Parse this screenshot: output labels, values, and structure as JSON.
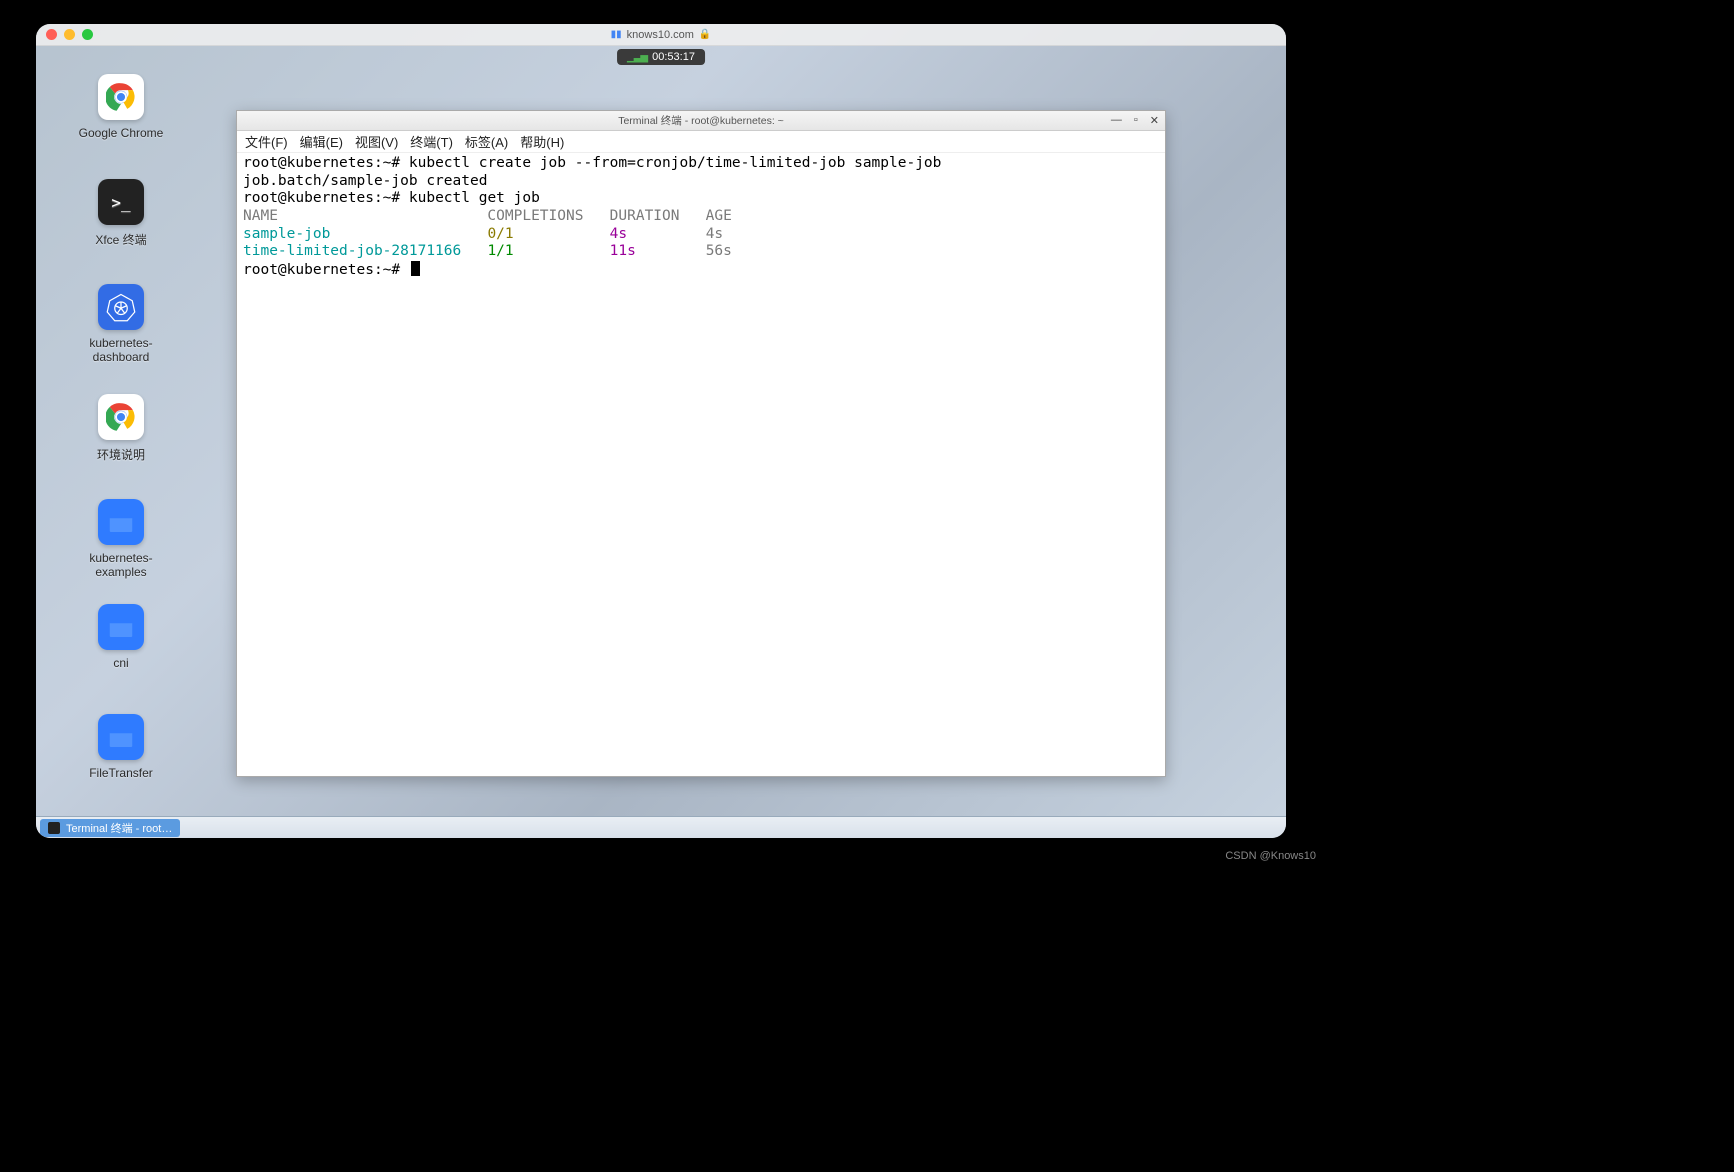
{
  "browser": {
    "url": "knows10.com",
    "timer": "00:53:17"
  },
  "desktop": {
    "icons": [
      {
        "label": "Google Chrome",
        "kind": "chrome"
      },
      {
        "label": "Xfce 终端",
        "kind": "term"
      },
      {
        "label": "kubernetes-\ndashboard",
        "kind": "k8s"
      },
      {
        "label": "环境说明",
        "kind": "chrome"
      },
      {
        "label": "kubernetes-\nexamples",
        "kind": "folder"
      },
      {
        "label": "cni",
        "kind": "folder"
      },
      {
        "label": "FileTransfer",
        "kind": "folder"
      }
    ]
  },
  "taskbar": {
    "item": "Terminal 终端 - root…"
  },
  "terminal": {
    "title": "Terminal 终端 - root@kubernetes: ~",
    "menu": [
      "文件(F)",
      "编辑(E)",
      "视图(V)",
      "终端(T)",
      "标签(A)",
      "帮助(H)"
    ],
    "prompt": "root@kubernetes:~#",
    "cmd1": "kubectl create job --from=cronjob/time-limited-job sample-job",
    "resp1": "job.batch/sample-job created",
    "cmd2": "kubectl get job",
    "header": {
      "c1": "NAME",
      "c2": "COMPLETIONS",
      "c3": "DURATION",
      "c4": "AGE"
    },
    "rows": [
      {
        "name": "sample-job",
        "comp": "0/1",
        "dur": "4s",
        "age": "4s",
        "compClass": "c-olive"
      },
      {
        "name": "time-limited-job-28171166",
        "comp": "1/1",
        "dur": "11s",
        "age": "56s",
        "compClass": "c-green"
      }
    ]
  },
  "watermark": "CSDN @Knows10"
}
